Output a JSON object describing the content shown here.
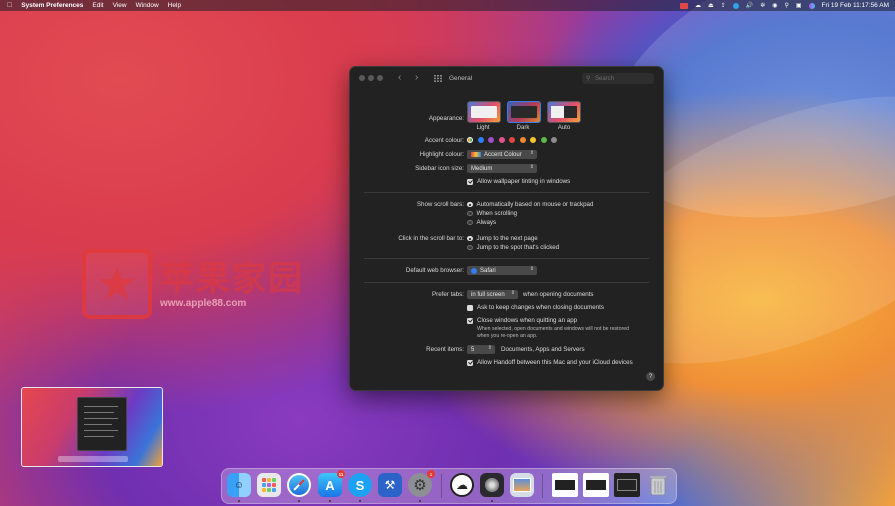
{
  "menubar": {
    "app_name": "System Preferences",
    "menus": [
      "Edit",
      "View",
      "Window",
      "Help"
    ],
    "clock": "Fri 19 Feb  11:17:56 AM"
  },
  "watermark": {
    "chinese": "苹果家园",
    "url": "www.apple88.com"
  },
  "window": {
    "title": "General",
    "search_placeholder": "Search",
    "appearance": {
      "label": "Appearance:",
      "options": [
        "Light",
        "Dark",
        "Auto"
      ],
      "selected": "Dark"
    },
    "accent": {
      "label": "Accent colour:",
      "colors": [
        "#9a9a9a",
        "#2f7ef5",
        "#9f4fc9",
        "#e5508f",
        "#e34444",
        "#f08a2a",
        "#f5c42e",
        "#5cb848",
        "#8c8c8c"
      ]
    },
    "highlight": {
      "label": "Highlight colour:",
      "value": "Accent Colour"
    },
    "sidebar_size": {
      "label": "Sidebar icon size:",
      "value": "Medium"
    },
    "tinting": {
      "label": "Allow wallpaper tinting in windows",
      "checked": true
    },
    "scroll_bars": {
      "label": "Show scroll bars:",
      "options": [
        "Automatically based on mouse or trackpad",
        "When scrolling",
        "Always"
      ],
      "selected": 0
    },
    "click_scroll": {
      "label": "Click in the scroll bar to:",
      "options": [
        "Jump to the next page",
        "Jump to the spot that's clicked"
      ],
      "selected": 0
    },
    "browser": {
      "label": "Default web browser:",
      "value": "Safari"
    },
    "tabs": {
      "label": "Prefer tabs:",
      "value": "in full screen",
      "suffix": "when opening documents"
    },
    "ask_keep": {
      "label": "Ask to keep changes when closing documents",
      "checked": false
    },
    "close_windows": {
      "label": "Close windows when quitting an app",
      "checked": true,
      "note1": "When selected, open documents and windows will not be restored",
      "note2": "when you re-open an app."
    },
    "recent": {
      "label": "Recent items:",
      "value": "5",
      "suffix": "Documents, Apps and Servers"
    },
    "handoff": {
      "label": "Allow Handoff between this Mac and your iCloud devices",
      "checked": true
    },
    "help": "?"
  },
  "dock": {
    "app_store_badge": "11",
    "settings_badge": "1"
  }
}
